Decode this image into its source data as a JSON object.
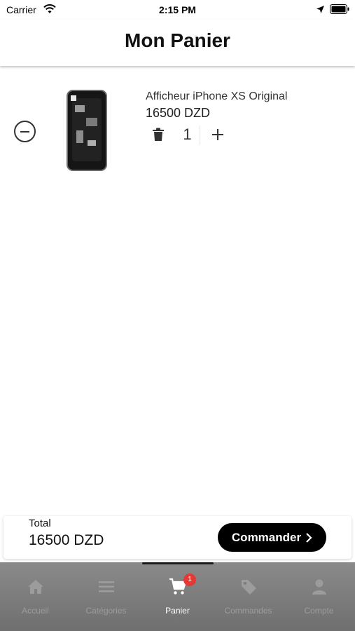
{
  "status_bar": {
    "carrier": "Carrier",
    "time": "2:15 PM"
  },
  "header": {
    "title": "Mon Panier"
  },
  "cart": {
    "items": [
      {
        "name": "Afficheur iPhone XS Original",
        "price": "16500 DZD",
        "quantity": "1"
      }
    ]
  },
  "summary": {
    "total_label": "Total",
    "total_value": "16500 DZD",
    "checkout_label": "Commander"
  },
  "tab_bar": {
    "tabs": [
      {
        "label": "Accueil",
        "icon": "home-icon"
      },
      {
        "label": "Catégories",
        "icon": "menu-icon"
      },
      {
        "label": "Panier",
        "icon": "cart-icon"
      },
      {
        "label": "Commandes",
        "icon": "tag-icon"
      },
      {
        "label": "Compte",
        "icon": "user-icon"
      }
    ],
    "active": "Panier",
    "cart_badge": "1"
  },
  "colors": {
    "accent": "#000000",
    "badge": "#e53935",
    "tab_bar": "#7d7d7d"
  }
}
